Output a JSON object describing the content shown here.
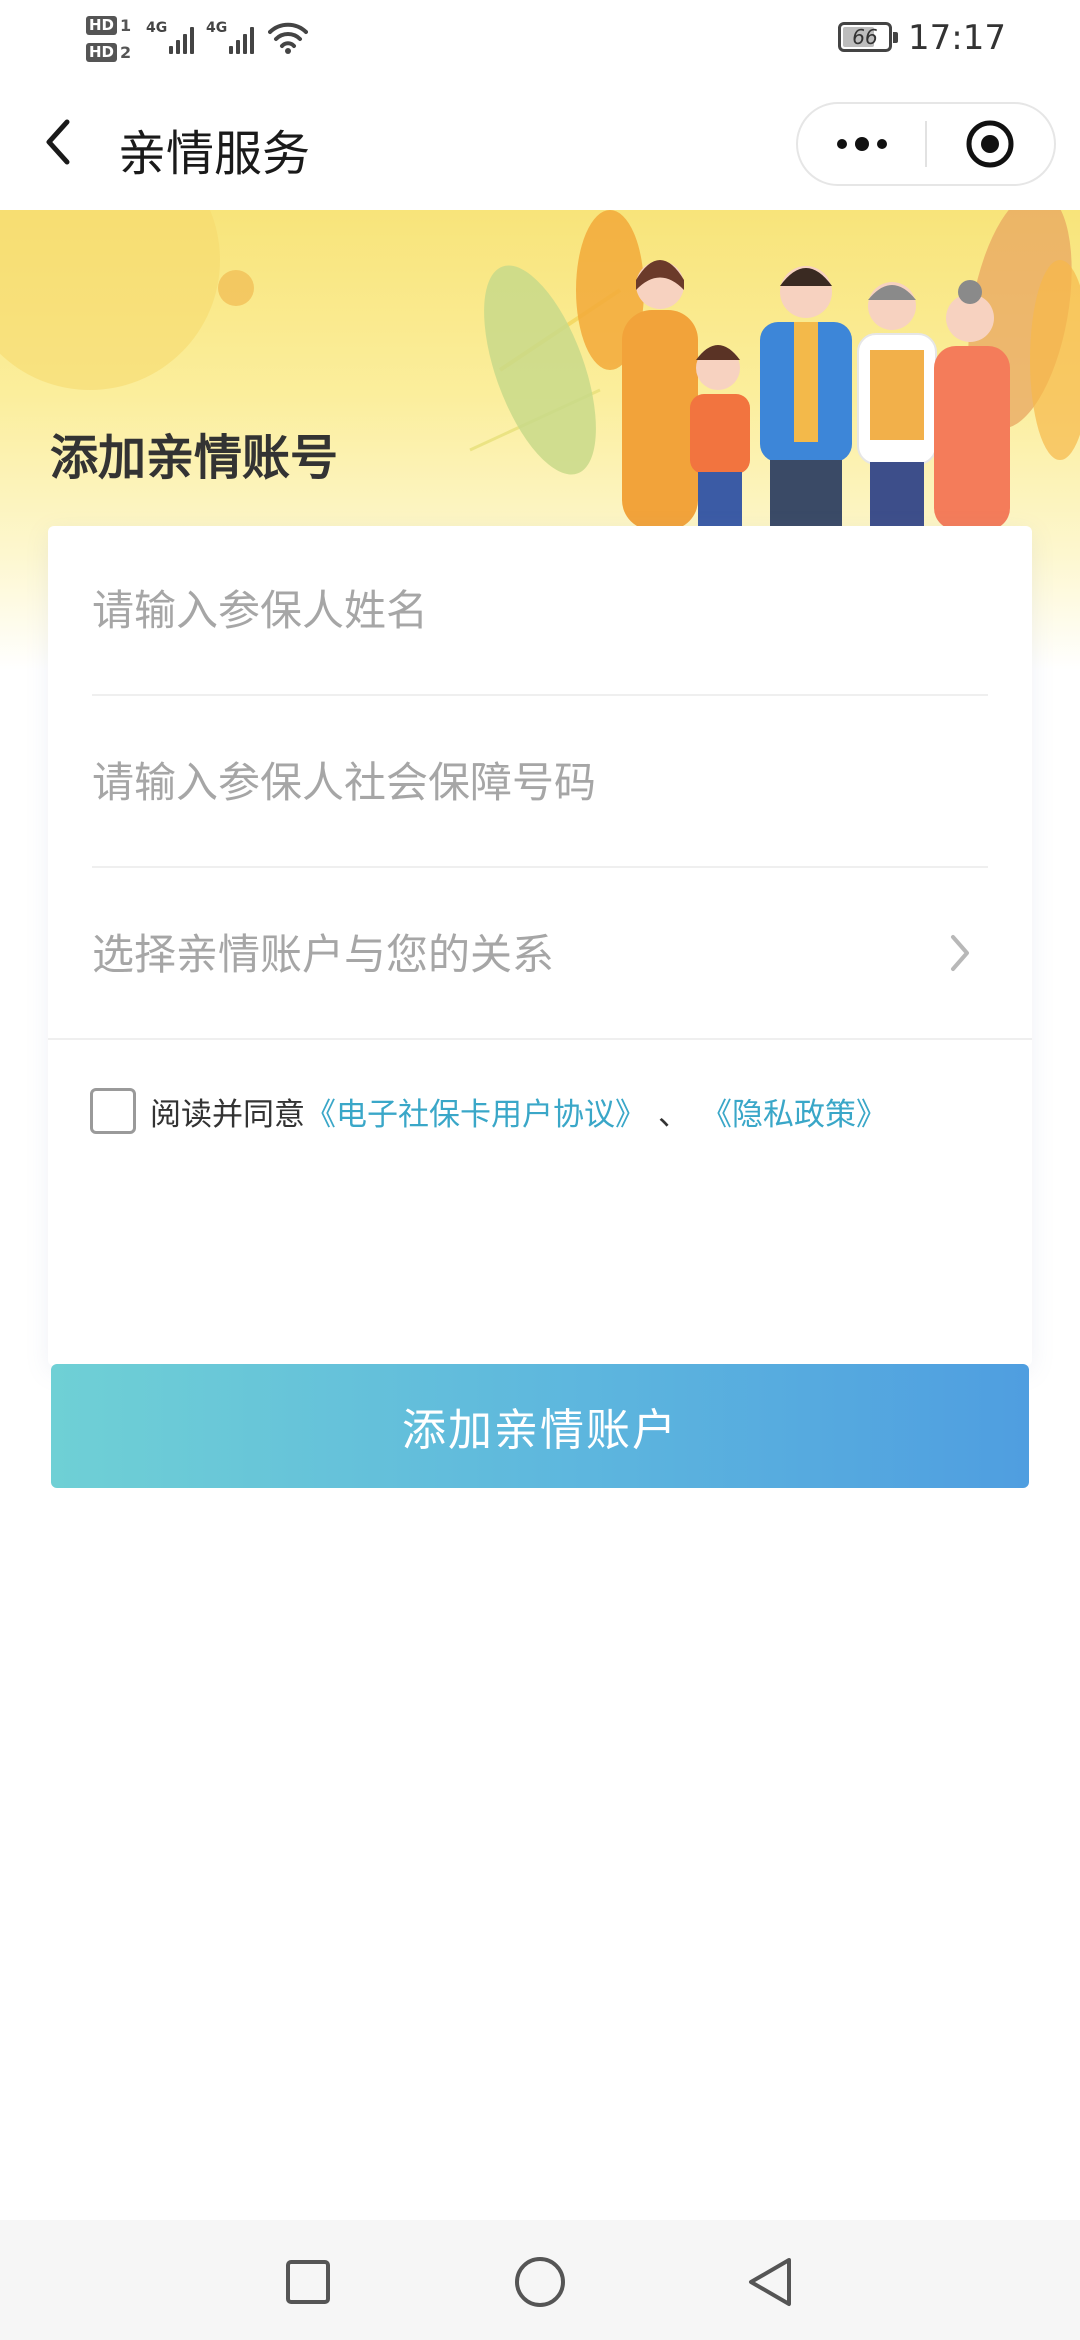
{
  "status_bar": {
    "sim1": {
      "badge": "HD",
      "slot": "1",
      "network": "4G"
    },
    "sim2": {
      "badge": "HD",
      "slot": "2",
      "network": "4G"
    },
    "battery_level": "66",
    "time": "17:17"
  },
  "nav": {
    "back_icon": "chevron-left-icon",
    "title": "亲情服务",
    "more_icon": "more-dots-icon",
    "close_icon": "target-close-icon"
  },
  "banner": {
    "title": "添加亲情账号",
    "illustration": "family-illustration"
  },
  "form": {
    "name_placeholder": "请输入参保人姓名",
    "name_value": "",
    "ssn_placeholder": "请输入参保人社会保障号码",
    "ssn_value": "",
    "relation_placeholder": "选择亲情账户与您的关系",
    "relation_icon": "chevron-right-icon",
    "agree_checked": false,
    "agree_prefix": "阅读并同意",
    "agree_link1": "《电子社保卡用户协议》",
    "agree_sep": "、",
    "agree_link2": "《隐私政策》",
    "submit_label": "添加亲情账户"
  },
  "colors": {
    "link": "#3aa7c8",
    "button_start": "#6fd0d5",
    "button_end": "#4f9ee0",
    "banner": "#f8e47a"
  },
  "system_nav": {
    "recent_icon": "square-icon",
    "home_icon": "circle-icon",
    "back_icon": "triangle-back-icon"
  }
}
